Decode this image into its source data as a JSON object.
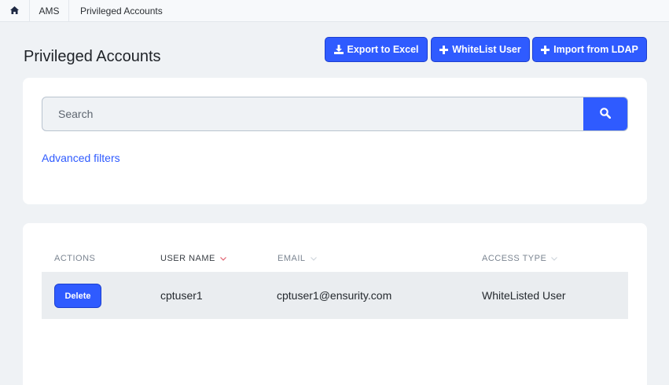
{
  "breadcrumb": {
    "items": [
      "AMS",
      "Privileged Accounts"
    ]
  },
  "page": {
    "title": "Privileged Accounts"
  },
  "toolbar": {
    "export_label": "Export to Excel",
    "whitelist_label": "WhiteList User",
    "import_label": "Import from LDAP"
  },
  "search": {
    "placeholder": "Search",
    "advanced_filters_label": "Advanced filters"
  },
  "table": {
    "columns": [
      "ACTIONS",
      "USER NAME",
      "EMAIL",
      "ACCESS TYPE"
    ],
    "sorted_column": "USER NAME",
    "rows": [
      {
        "action_label": "Delete",
        "user_name": "cptuser1",
        "email": "cptuser1@ensurity.com",
        "access_type": "WhiteListed User"
      }
    ]
  },
  "colors": {
    "accent": "#2f5bff",
    "background": "#eff2f5",
    "row_highlight": "#eaedf0",
    "sort_indicator_active": "#e0606e"
  },
  "icons": {
    "home": "home-icon",
    "export": "download-icon",
    "whitelist": "plus-icon",
    "import": "plus-icon",
    "search": "search-icon",
    "sort": "chevron-down-icon"
  }
}
